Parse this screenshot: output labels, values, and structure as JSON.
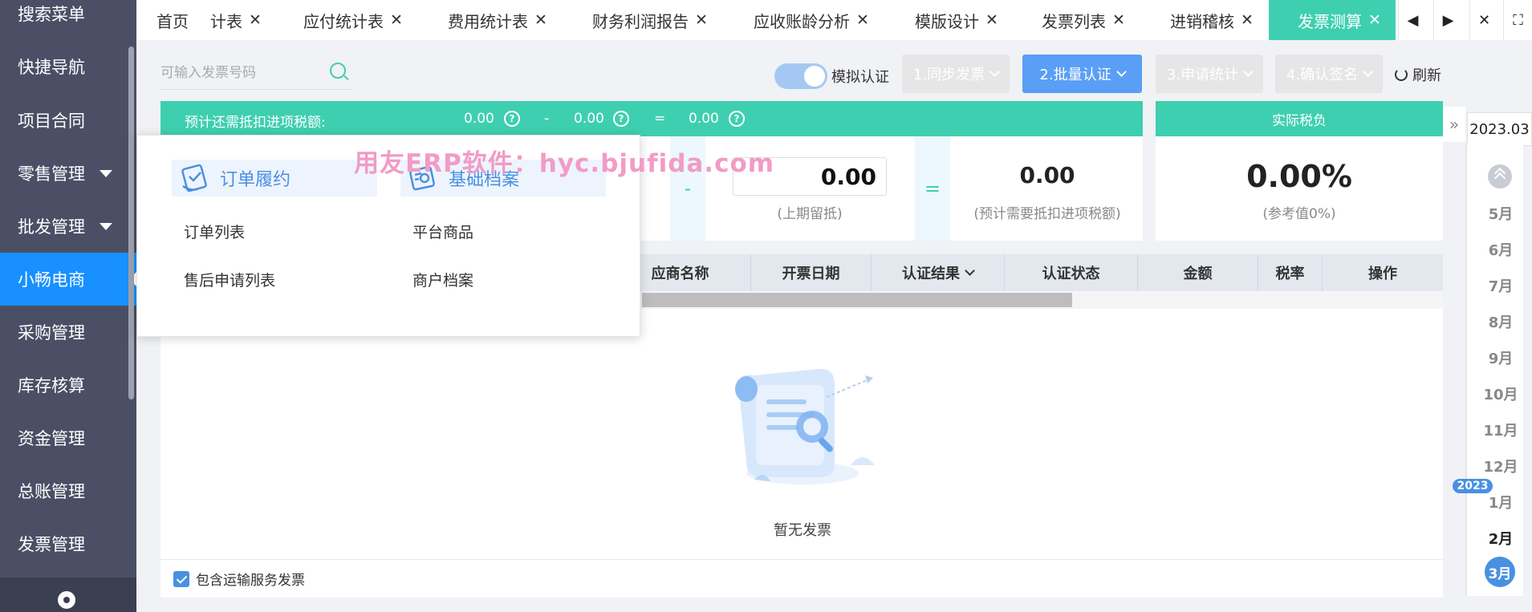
{
  "sidebar": {
    "items": [
      {
        "label": "搜索菜单"
      },
      {
        "label": "快捷导航"
      },
      {
        "label": "项目合同"
      },
      {
        "label": "零售管理"
      },
      {
        "label": "批发管理"
      },
      {
        "label": "小畅电商"
      },
      {
        "label": "采购管理"
      },
      {
        "label": "库存核算"
      },
      {
        "label": "资金管理"
      },
      {
        "label": "总账管理"
      },
      {
        "label": "发票管理"
      }
    ]
  },
  "tabs": [
    {
      "label": "首页"
    },
    {
      "label": "计表"
    },
    {
      "label": "应付统计表"
    },
    {
      "label": "费用统计表"
    },
    {
      "label": "财务利润报告"
    },
    {
      "label": "应收账龄分析"
    },
    {
      "label": "模版设计"
    },
    {
      "label": "发票列表"
    },
    {
      "label": "进销稽核"
    },
    {
      "label": "发票测算"
    }
  ],
  "toolbar": {
    "search_placeholder": "可输入发票号码",
    "toggle_label": "模拟认证",
    "toggle_on": true,
    "btn_sync": "1.同步发票",
    "btn_batch": "2.批量认证",
    "btn_apply": "3.申请统计",
    "btn_confirm": "4.确认签名",
    "refresh_label": "刷新"
  },
  "summary": {
    "head_label": "预计还需抵扣进项税额:",
    "head_v1": "0.00",
    "head_minus": "-",
    "head_v2": "0.00",
    "head_eq": "=",
    "head_v3": "0.00",
    "minus": "-",
    "eq": "=",
    "prev_value": "0.00",
    "prev_label": "(上期留抵)",
    "need_value": "0.00",
    "need_label": "(预计需要抵扣进项税额)",
    "tax_head": "实际税负",
    "tax_value": "0.00%",
    "tax_label": "(参考值0%)"
  },
  "table": {
    "columns": [
      "应商名称",
      "开票日期",
      "认证结果",
      "认证状态",
      "金额",
      "税率",
      "操作"
    ],
    "empty_text": "暂无发票"
  },
  "footer": {
    "checkbox_label": "包含运输服务发票",
    "checked": true
  },
  "dates": {
    "current": "2023.03",
    "year_badge": "2023",
    "months": [
      "5月",
      "6月",
      "7月",
      "8月",
      "9月",
      "10月",
      "11月",
      "12月",
      "1月",
      "2月"
    ],
    "selected": "3月"
  },
  "dropdown": {
    "group1_title": "订单履约",
    "group1_items": [
      "订单列表",
      "售后申请列表"
    ],
    "group2_title": "基础档案",
    "group2_items": [
      "平台商品",
      "商户档案"
    ]
  },
  "watermark": "用友ERP软件：hyc.bjufida.com",
  "colors": {
    "sidebar_bg": "#4a4f66",
    "accent_teal": "#3ecfb0",
    "primary_blue": "#5a9ef6",
    "active_side": "#1890ff"
  }
}
